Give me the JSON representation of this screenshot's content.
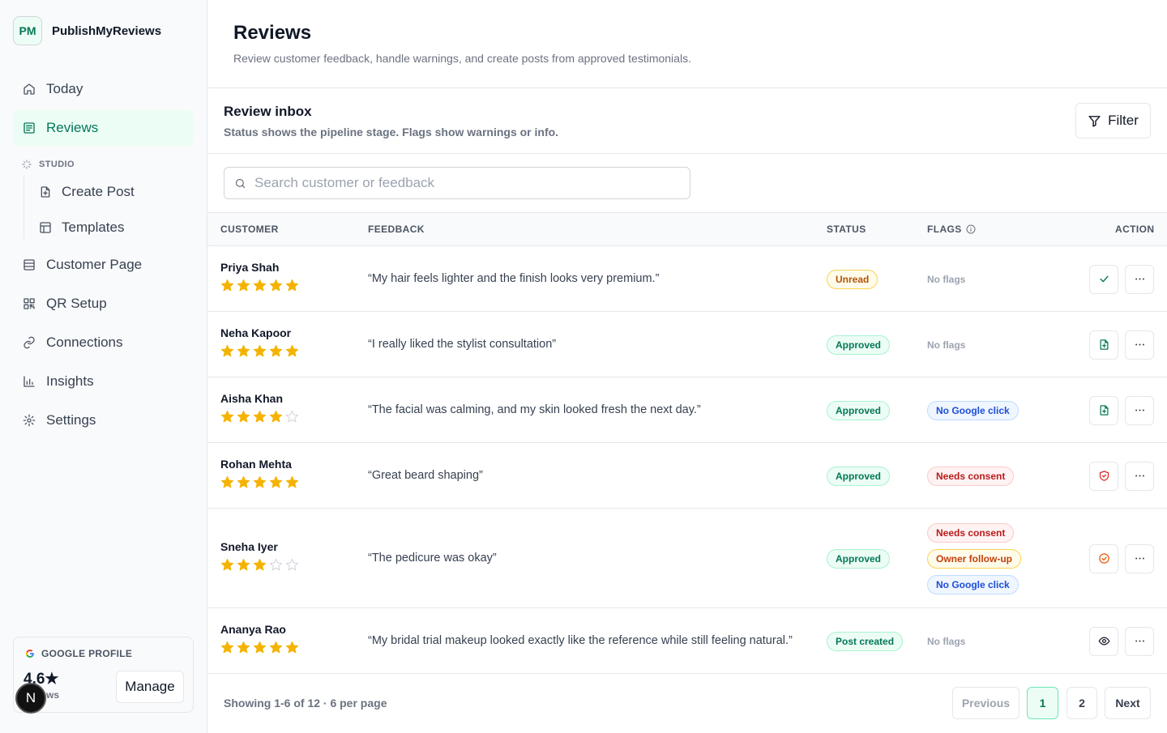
{
  "brand": {
    "logo": "PM",
    "name": "PublishMyReviews"
  },
  "nav": {
    "today": "Today",
    "reviews": "Reviews",
    "studio_label": "STUDIO",
    "create_post": "Create Post",
    "templates": "Templates",
    "customer_page": "Customer Page",
    "qr_setup": "QR Setup",
    "connections": "Connections",
    "insights": "Insights",
    "settings": "Settings"
  },
  "google_profile": {
    "label": "GOOGLE PROFILE",
    "rating": "4.6★",
    "sub": "reviews",
    "manage": "Manage"
  },
  "avatar_letter": "N",
  "header": {
    "title": "Reviews",
    "subtitle": "Review customer feedback, handle warnings, and create posts from approved testimonials."
  },
  "inbox": {
    "title": "Review inbox",
    "subtitle": "Status shows the pipeline stage. Flags show warnings or info.",
    "filter": "Filter",
    "search_placeholder": "Search customer or feedback"
  },
  "columns": {
    "customer": "CUSTOMER",
    "feedback": "FEEDBACK",
    "status": "STATUS",
    "flags": "FLAGS",
    "action": "ACTION"
  },
  "rows": [
    {
      "name": "Priya Shah",
      "rating": 5,
      "feedback": "“My hair feels lighter and the finish looks very premium.”",
      "status": "Unread",
      "status_kind": "unread",
      "flags": [
        {
          "label": "No flags",
          "kind": "none"
        }
      ],
      "action_icon": "check-icon"
    },
    {
      "name": "Neha Kapoor",
      "rating": 5,
      "feedback": "“I really liked the stylist consultation”",
      "status": "Approved",
      "status_kind": "approved",
      "flags": [
        {
          "label": "No flags",
          "kind": "none"
        }
      ],
      "action_icon": "file-plus-icon"
    },
    {
      "name": "Aisha Khan",
      "rating": 4,
      "feedback": "“The facial was calming, and my skin looked fresh the next day.”",
      "status": "Approved",
      "status_kind": "approved",
      "flags": [
        {
          "label": "No Google click",
          "kind": "google"
        }
      ],
      "action_icon": "file-plus-icon"
    },
    {
      "name": "Rohan Mehta",
      "rating": 5,
      "feedback": "“Great beard shaping”",
      "status": "Approved",
      "status_kind": "approved",
      "flags": [
        {
          "label": "Needs consent",
          "kind": "consent"
        }
      ],
      "action_icon": "shield-icon"
    },
    {
      "name": "Sneha Iyer",
      "rating": 3,
      "feedback": "“The pedicure was okay”",
      "status": "Approved",
      "status_kind": "approved",
      "flags": [
        {
          "label": "Needs consent",
          "kind": "consent"
        },
        {
          "label": "Owner follow-up",
          "kind": "follow"
        },
        {
          "label": "No Google click",
          "kind": "google"
        }
      ],
      "action_icon": "check-circle-icon"
    },
    {
      "name": "Ananya Rao",
      "rating": 5,
      "feedback": "“My bridal trial makeup looked exactly like the reference while still feeling natural.”",
      "status": "Post created",
      "status_kind": "approved",
      "flags": [
        {
          "label": "No flags",
          "kind": "none"
        }
      ],
      "action_icon": "eye-icon"
    }
  ],
  "footer": {
    "showing": "Showing 1-6 of 12 · 6 per page",
    "previous": "Previous",
    "page1": "1",
    "page2": "2",
    "next": "Next"
  },
  "colors": {
    "accent": "#047857",
    "accent_bg": "#ecfdf5",
    "star": "#f5b301",
    "star_empty": "#d1d5db"
  }
}
